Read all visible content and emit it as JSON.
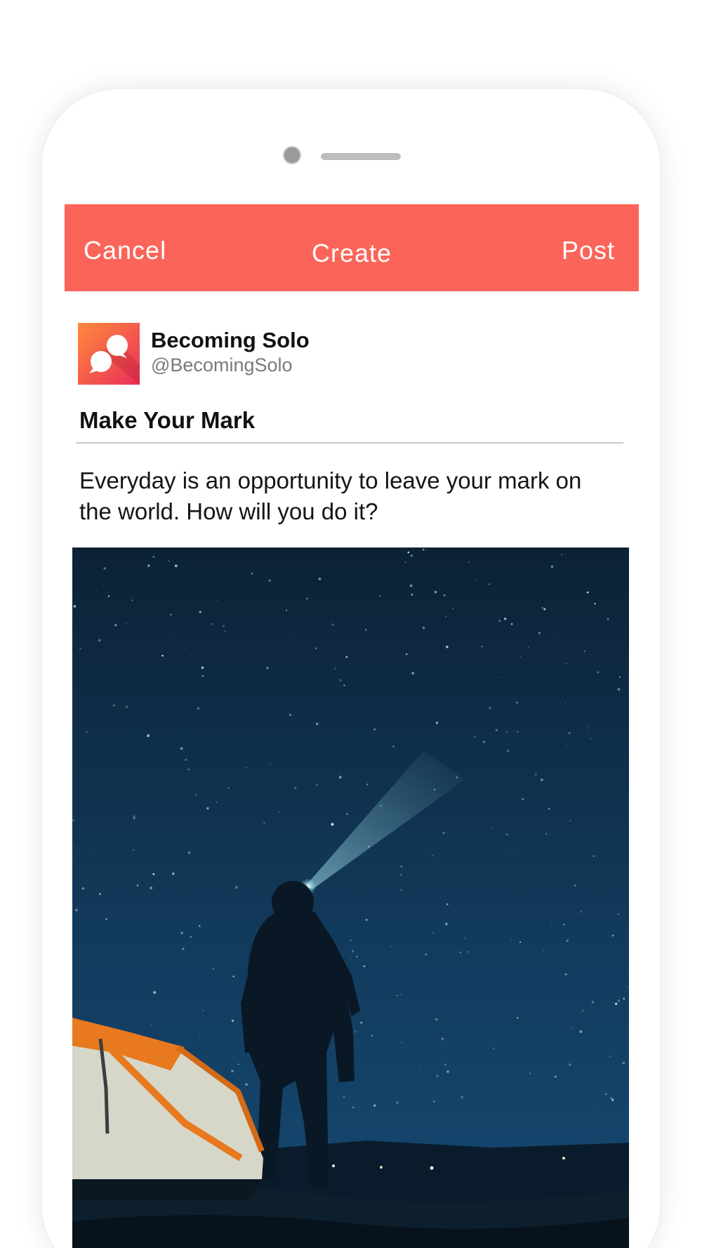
{
  "colors": {
    "accent": "#FB6559",
    "avatar_gradient_start": "#FF8A3D",
    "avatar_gradient_end": "#EA2F59",
    "sky_top": "#0C2236",
    "sky_bottom": "#154A73",
    "tent_orange": "#E8791E"
  },
  "header": {
    "cancel_label": "Cancel",
    "title": "Create",
    "post_label": "Post"
  },
  "profile": {
    "avatar_icon": "speech-bubbles-logo-icon",
    "display_name": "Becoming Solo",
    "handle": "@BecomingSolo"
  },
  "post": {
    "title": "Make Your Mark",
    "body": "Everyday is an opportunity to leave your mark on the world. How will you do it?",
    "image_subject": "night-sky-hiker-tent-photo"
  }
}
